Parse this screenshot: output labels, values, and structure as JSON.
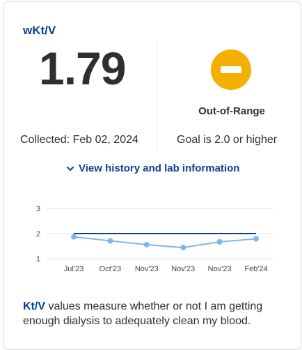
{
  "card": {
    "title": "wKt/V",
    "value": "1.79",
    "status": {
      "label": "Out-of-Range",
      "color": "#f4b000",
      "icon": "minus-circle-icon"
    },
    "collected": "Collected: Feb 02, 2024",
    "goal": "Goal is 2.0 or higher",
    "history_link": "View history and lab information",
    "description": {
      "term": "Kt/V",
      "text": " values measure whether or not I am getting enough dialysis to adequately clean my blood."
    }
  },
  "colors": {
    "title": "#0b3f8f",
    "series": "#7fb6e8",
    "goal_line": "#0b3f8f",
    "status": "#f4b000"
  },
  "chart_data": {
    "type": "line",
    "categories": [
      "Jul'23",
      "Oct'23",
      "Nov'23",
      "Nov'23",
      "Nov'23",
      "Feb'24"
    ],
    "series": [
      {
        "values": [
          1.87,
          1.71,
          1.56,
          1.44,
          1.67,
          1.79
        ]
      }
    ],
    "goal": 2.0,
    "yticks": [
      1,
      2,
      3
    ],
    "ylim": [
      1,
      3
    ],
    "grid": true
  }
}
